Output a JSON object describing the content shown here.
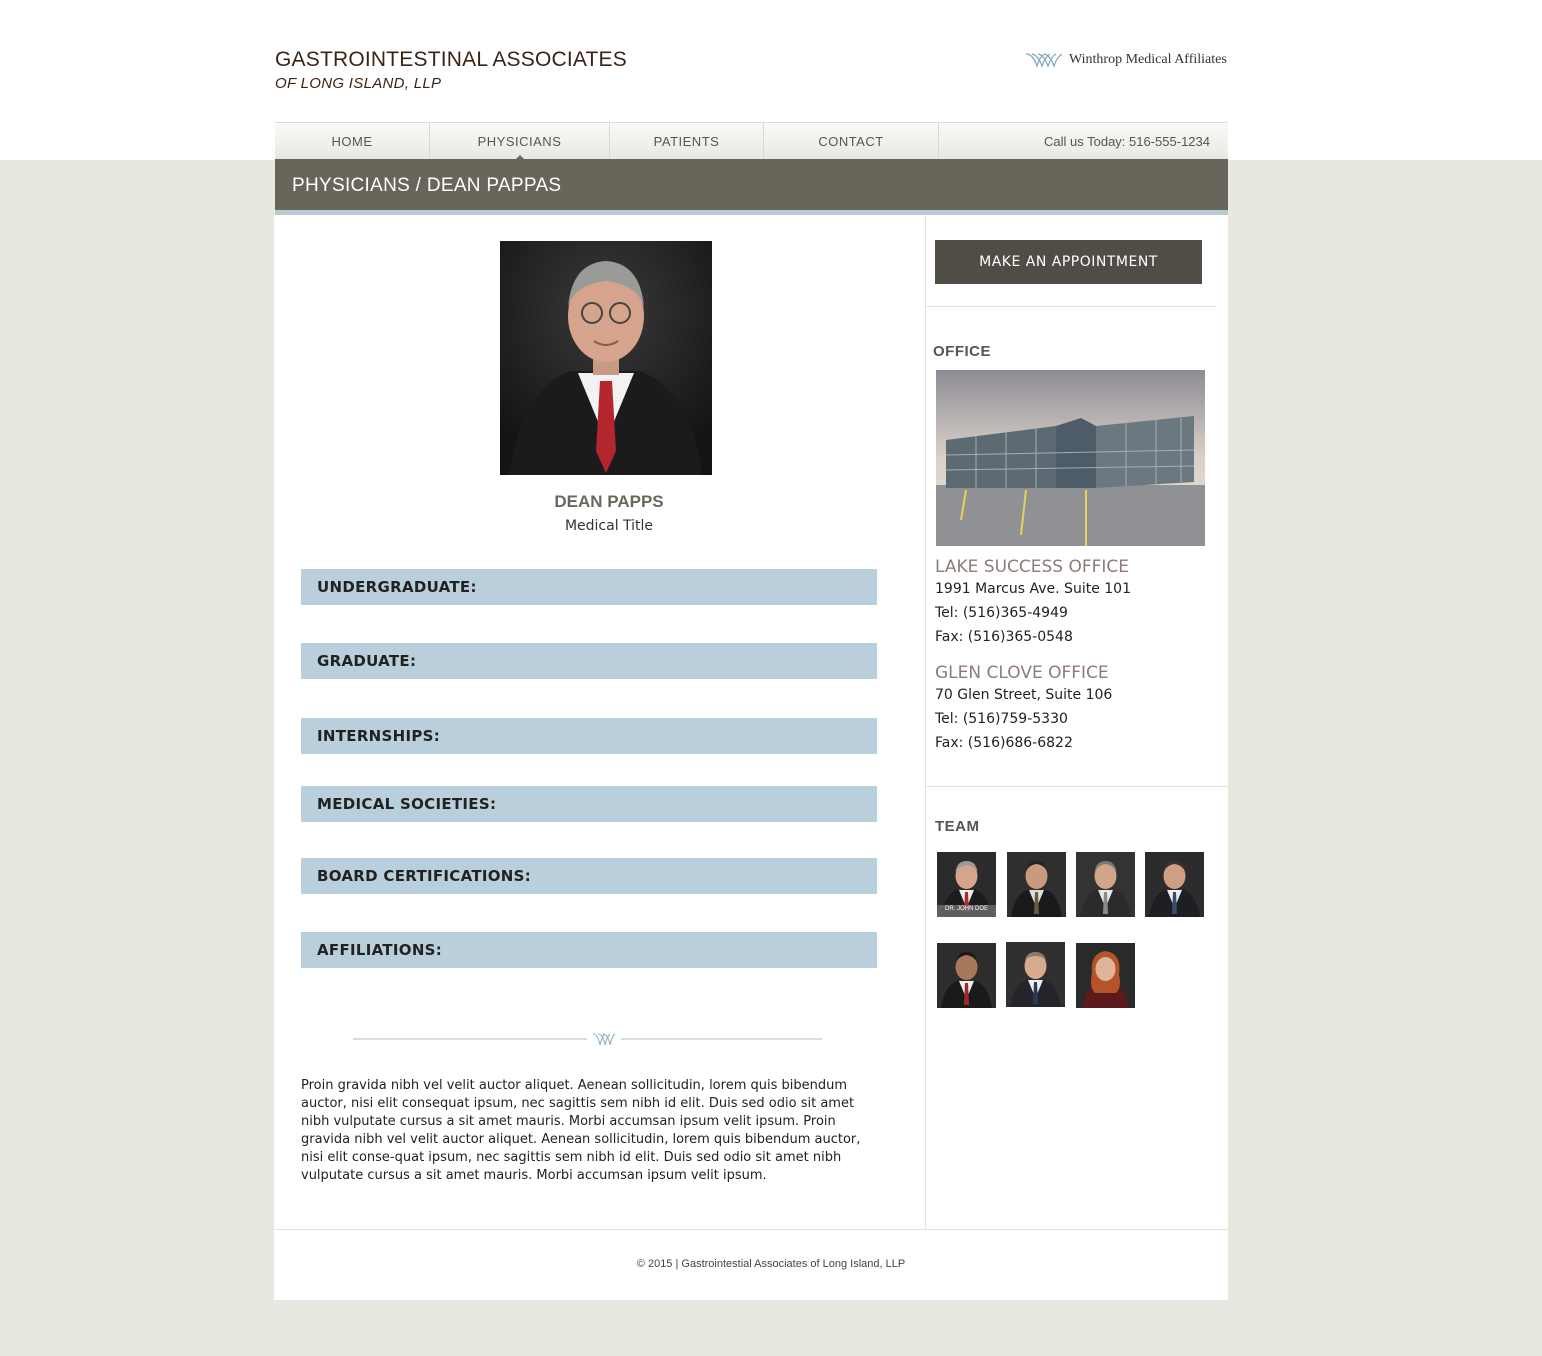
{
  "header": {
    "logo_line1": "GASTROINTESTINAL ASSOCIATES",
    "logo_line2": "OF LONG ISLAND, LLP",
    "affiliate_name": "Winthrop Medical Affiliates"
  },
  "nav": {
    "items": [
      {
        "label": "HOME"
      },
      {
        "label": "PHYSICIANS",
        "active": true
      },
      {
        "label": "PATIENTS"
      },
      {
        "label": "CONTACT"
      }
    ],
    "phone": "Call us Today: 516-555-1234"
  },
  "page_title": "PHYSICIANS / DEAN PAPPAS",
  "physician": {
    "name": "DEAN PAPPS",
    "title": "Medical  Title"
  },
  "sections": [
    {
      "label": "UNDERGRADUATE:"
    },
    {
      "label": "GRADUATE:"
    },
    {
      "label": "INTERNSHIPS:"
    },
    {
      "label": "MEDICAL SOCIETIES:"
    },
    {
      "label": "BOARD CERTIFICATIONS:"
    },
    {
      "label": "AFFILIATIONS:"
    }
  ],
  "bio": "Proin gravida nibh vel velit auctor aliquet. Aenean sollicitudin, lorem quis bibendum auctor, nisi elit consequat ipsum, nec sagittis sem nibh id elit. Duis sed odio sit amet nibh vulputate cursus a sit amet mauris. Morbi accumsan ipsum velit ipsum. Proin gravida nibh vel velit auctor aliquet. Aenean sollicitudin, lorem quis bibendum auctor, nisi elit conse-quat ipsum, nec sagittis sem nibh id elit. Duis sed odio sit amet nibh vulputate cursus a sit amet mauris. Morbi accumsan ipsum velit ipsum.",
  "sidebar": {
    "appointment_button": "MAKE AN APPOINTMENT",
    "office_heading": "OFFICE",
    "offices": [
      {
        "name": "LAKE SUCCESS OFFICE",
        "address": "1991 Marcus Ave. Suite 101",
        "tel": "Tel: (516)365-4949",
        "fax": "Fax: (516)365-0548"
      },
      {
        "name": "GLEN CLOVE OFFICE",
        "address": "70 Glen Street, Suite 106",
        "tel": "Tel: (516)759-5330",
        "fax": "Fax: (516)686-6822"
      }
    ],
    "team_heading": "TEAM",
    "team_caption": "DR. JOHN  DOE"
  },
  "footer": "© 2015 | Gastrointestial Associates of Long Island, LLP",
  "colors": {
    "title_bar": "#68665b",
    "section_bar": "#bacfdc",
    "button": "#4f4d46",
    "page_bg": "#e8e8e1",
    "office_name": "#8c7c78"
  }
}
